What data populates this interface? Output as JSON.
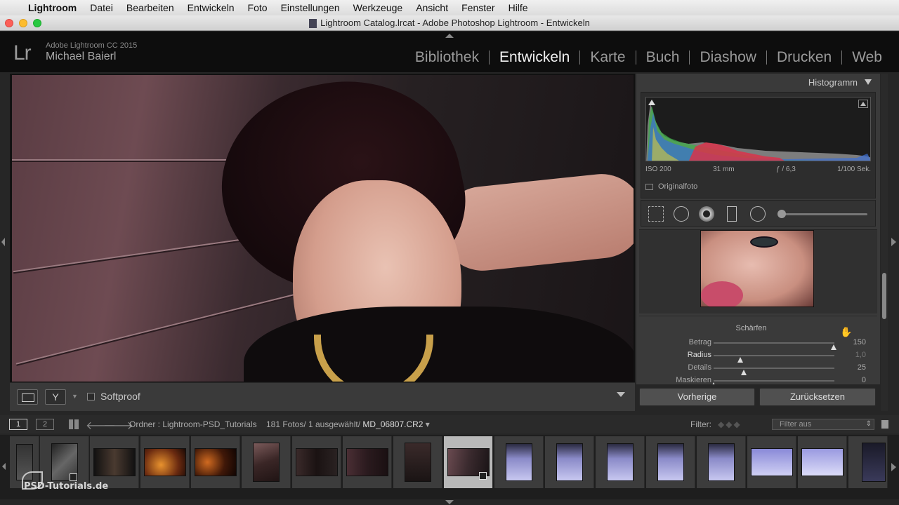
{
  "menubar": {
    "app_name": "Lightroom",
    "items": [
      "Datei",
      "Bearbeiten",
      "Entwickeln",
      "Foto",
      "Einstellungen",
      "Werkzeuge",
      "Ansicht",
      "Fenster",
      "Hilfe"
    ]
  },
  "window": {
    "title": "Lightroom Catalog.lrcat - Adobe Photoshop Lightroom - Entwickeln"
  },
  "identity": {
    "logo": "Lr",
    "product": "Adobe Lightroom CC 2015",
    "user": "Michael Baierl"
  },
  "modules": {
    "items": [
      "Bibliothek",
      "Entwickeln",
      "Karte",
      "Buch",
      "Diashow",
      "Drucken",
      "Web"
    ],
    "active": "Entwickeln"
  },
  "toolbar": {
    "softproof_label": "Softproof",
    "softproof_checked": false
  },
  "histogram": {
    "title": "Histogramm",
    "exif": {
      "iso": "ISO 200",
      "focal": "31 mm",
      "aperture": "ƒ / 6,3",
      "shutter": "1/100 Sek."
    },
    "original_label": "Originalfoto"
  },
  "sharpen": {
    "title": "Schärfen",
    "rows": [
      {
        "label": "Betrag",
        "value": "150",
        "level": 0.993
      },
      {
        "label": "Radius",
        "value": "1,0",
        "level": 0.222
      },
      {
        "label": "Details",
        "value": "25",
        "level": 0.25
      },
      {
        "label": "Maskieren",
        "value": "0",
        "level": 0.0
      }
    ]
  },
  "buttons": {
    "previous": "Vorherige",
    "reset": "Zurücksetzen"
  },
  "filmstrip_bar": {
    "screen1": "1",
    "screen2": "2",
    "path_prefix": "Ordner : Lightroom-PSD_Tutorials",
    "counts": "181 Fotos/ 1 ausgewählt/",
    "filename": "MD_06807.CR2",
    "filter_label": "Filter:",
    "filter_value": "Filter aus"
  },
  "watermark": "PSD-Tutorials.de",
  "colors": {
    "accent_active": "#f0f0f0",
    "panel": "#3a3a3a",
    "selected_cell": "#b9b9b9"
  }
}
